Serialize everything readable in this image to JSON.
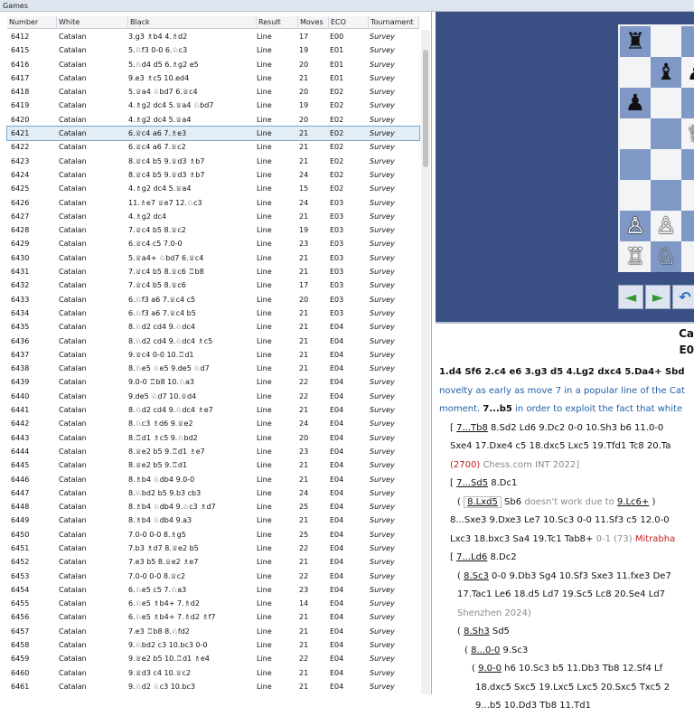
{
  "window": {
    "title": "Games"
  },
  "table": {
    "columns": [
      "Number",
      "White",
      "Black",
      "Result",
      "Moves",
      "ECO",
      "Tournament"
    ],
    "selected_number": "6421",
    "rows": [
      [
        "6412",
        "Catalan",
        "3.g3 ♗b4 4.♗d2",
        "Line",
        "17",
        "E00",
        "Survey"
      ],
      [
        "6415",
        "Catalan",
        "5.♘f3 0-0 6.♘c3",
        "Line",
        "19",
        "E01",
        "Survey"
      ],
      [
        "6416",
        "Catalan",
        "5.♘d4 d5 6.♗g2 e5",
        "Line",
        "20",
        "E01",
        "Survey"
      ],
      [
        "6417",
        "Catalan",
        "9.e3 ♗c5 10.ed4",
        "Line",
        "21",
        "E01",
        "Survey"
      ],
      [
        "6418",
        "Catalan",
        "5.♕a4 ♘bd7 6.♕c4",
        "Line",
        "20",
        "E02",
        "Survey"
      ],
      [
        "6419",
        "Catalan",
        "4.♗g2 dc4 5.♕a4 ♘bd7",
        "Line",
        "19",
        "E02",
        "Survey"
      ],
      [
        "6420",
        "Catalan",
        "4.♗g2 dc4 5.♕a4",
        "Line",
        "20",
        "E02",
        "Survey"
      ],
      [
        "6421",
        "Catalan",
        "6.♕c4 a6 7.♗e3",
        "Line",
        "21",
        "E02",
        "Survey"
      ],
      [
        "6422",
        "Catalan",
        "6.♕c4 a6 7.♕c2",
        "Line",
        "21",
        "E02",
        "Survey"
      ],
      [
        "6423",
        "Catalan",
        "8.♕c4 b5 9.♕d3 ♗b7",
        "Line",
        "21",
        "E02",
        "Survey"
      ],
      [
        "6424",
        "Catalan",
        "8.♕c4 b5 9.♕d3 ♗b7",
        "Line",
        "24",
        "E02",
        "Survey"
      ],
      [
        "6425",
        "Catalan",
        "4.♗g2 dc4 5.♕a4",
        "Line",
        "15",
        "E02",
        "Survey"
      ],
      [
        "6426",
        "Catalan",
        "11.♗e7 ♕e7 12.♘c3",
        "Line",
        "24",
        "E03",
        "Survey"
      ],
      [
        "6427",
        "Catalan",
        "4.♗g2 dc4",
        "Line",
        "21",
        "E03",
        "Survey"
      ],
      [
        "6428",
        "Catalan",
        "7.♕c4 b5 8.♕c2",
        "Line",
        "19",
        "E03",
        "Survey"
      ],
      [
        "6429",
        "Catalan",
        "6.♕c4 c5 7.0-0",
        "Line",
        "23",
        "E03",
        "Survey"
      ],
      [
        "6430",
        "Catalan",
        "5.♕a4+ ♘bd7 6.♕c4",
        "Line",
        "21",
        "E03",
        "Survey"
      ],
      [
        "6431",
        "Catalan",
        "7.♕c4 b5 8.♕c6 ♖b8",
        "Line",
        "21",
        "E03",
        "Survey"
      ],
      [
        "6432",
        "Catalan",
        "7.♕c4 b5 8.♕c6",
        "Line",
        "17",
        "E03",
        "Survey"
      ],
      [
        "6433",
        "Catalan",
        "6.♘f3 a6 7.♕c4 c5",
        "Line",
        "20",
        "E03",
        "Survey"
      ],
      [
        "6434",
        "Catalan",
        "6.♘f3 a6 7.♕c4 b5",
        "Line",
        "21",
        "E03",
        "Survey"
      ],
      [
        "6435",
        "Catalan",
        "8.♘d2 cd4 9.♘dc4",
        "Line",
        "21",
        "E04",
        "Survey"
      ],
      [
        "6436",
        "Catalan",
        "8.♘d2 cd4 9.♘dc4 ♗c5",
        "Line",
        "21",
        "E04",
        "Survey"
      ],
      [
        "6437",
        "Catalan",
        "9.♕c4 0-0 10.♖d1",
        "Line",
        "21",
        "E04",
        "Survey"
      ],
      [
        "6438",
        "Catalan",
        "8.♘e5 ♘e5 9.de5 ♘d7",
        "Line",
        "21",
        "E04",
        "Survey"
      ],
      [
        "6439",
        "Catalan",
        "9.0-0 ♖b8 10.♘a3",
        "Line",
        "22",
        "E04",
        "Survey"
      ],
      [
        "6440",
        "Catalan",
        "9.de5 ♘d7 10.♕d4",
        "Line",
        "22",
        "E04",
        "Survey"
      ],
      [
        "6441",
        "Catalan",
        "8.♘d2 cd4 9.♘dc4 ♗e7",
        "Line",
        "21",
        "E04",
        "Survey"
      ],
      [
        "6442",
        "Catalan",
        "8.♘c3 ♗d6 9.♕e2",
        "Line",
        "24",
        "E04",
        "Survey"
      ],
      [
        "6443",
        "Catalan",
        "8.♖d1 ♗c5 9.♘bd2",
        "Line",
        "20",
        "E04",
        "Survey"
      ],
      [
        "6444",
        "Catalan",
        "8.♕e2 b5 9.♖d1 ♗e7",
        "Line",
        "23",
        "E04",
        "Survey"
      ],
      [
        "6445",
        "Catalan",
        "8.♕e2 b5 9.♖d1",
        "Line",
        "21",
        "E04",
        "Survey"
      ],
      [
        "6446",
        "Catalan",
        "8.♗b4 ♘db4 9.0-0",
        "Line",
        "21",
        "E04",
        "Survey"
      ],
      [
        "6447",
        "Catalan",
        "8.♘bd2 b5 9.b3 cb3",
        "Line",
        "24",
        "E04",
        "Survey"
      ],
      [
        "6448",
        "Catalan",
        "8.♗b4 ♘db4 9.♘c3 ♗d7",
        "Line",
        "25",
        "E04",
        "Survey"
      ],
      [
        "6449",
        "Catalan",
        "8.♗b4 ♘db4 9.a3",
        "Line",
        "21",
        "E04",
        "Survey"
      ],
      [
        "6450",
        "Catalan",
        "7.0-0 0-0 8.♗g5",
        "Line",
        "25",
        "E04",
        "Survey"
      ],
      [
        "6451",
        "Catalan",
        "7.b3 ♗d7 8.♕e2 b5",
        "Line",
        "22",
        "E04",
        "Survey"
      ],
      [
        "6452",
        "Catalan",
        "7.e3 b5 8.♕e2 ♗e7",
        "Line",
        "21",
        "E04",
        "Survey"
      ],
      [
        "6453",
        "Catalan",
        "7.0-0 0-0 8.♕c2",
        "Line",
        "22",
        "E04",
        "Survey"
      ],
      [
        "6454",
        "Catalan",
        "6.♘e5 c5 7.♘a3",
        "Line",
        "23",
        "E04",
        "Survey"
      ],
      [
        "6455",
        "Catalan",
        "6.♘e5 ♗b4+ 7.♗d2",
        "Line",
        "14",
        "E04",
        "Survey"
      ],
      [
        "6456",
        "Catalan",
        "6.♘e5 ♗b4+ 7.♗d2 ♗f7",
        "Line",
        "21",
        "E04",
        "Survey"
      ],
      [
        "6457",
        "Catalan",
        "7.e3 ♖b8 8.♘fd2",
        "Line",
        "21",
        "E04",
        "Survey"
      ],
      [
        "6458",
        "Catalan",
        "9.♘bd2 c3 10.bc3 0-0",
        "Line",
        "21",
        "E04",
        "Survey"
      ],
      [
        "6459",
        "Catalan",
        "9.♕e2 b5 10.♖d1 ♗e4",
        "Line",
        "22",
        "E04",
        "Survey"
      ],
      [
        "6460",
        "Catalan",
        "9.♕d3 c4 10.♕c2",
        "Line",
        "21",
        "E04",
        "Survey"
      ],
      [
        "6461",
        "Catalan",
        "9.♘d2 ♘c3 10.bc3",
        "Line",
        "21",
        "E04",
        "Survey"
      ]
    ]
  },
  "board": {
    "pieces": [
      {
        "sq": "a8",
        "glyph": "♜",
        "side": "black"
      },
      {
        "sq": "b7",
        "glyph": "♝",
        "side": "black"
      },
      {
        "sq": "c7",
        "glyph": "♟",
        "side": "black"
      },
      {
        "sq": "a6",
        "glyph": "♟",
        "side": "black"
      },
      {
        "sq": "c5",
        "glyph": "♕",
        "side": "white"
      },
      {
        "sq": "a2",
        "glyph": "♙",
        "side": "white"
      },
      {
        "sq": "b2",
        "glyph": "♙",
        "side": "white"
      },
      {
        "sq": "a1",
        "glyph": "♖",
        "side": "white"
      },
      {
        "sq": "b1",
        "glyph": "♘",
        "side": "white"
      }
    ]
  },
  "nav": {
    "back": "◄",
    "forward": "►",
    "undo": "↶"
  },
  "game": {
    "title": "Ca",
    "eco": "E0"
  },
  "notes": {
    "l1": "1.d4  Sf6  2.c4  e6  3.g3  d5  4.Lg2  dxc4  5.Da4+  Sbd",
    "l2": "novelty as early as move 7 in a popular line of the Cat",
    "l3a": "moment.",
    "l3b": "7...b5",
    "l3c": " in order to exploit the fact that white",
    "l4a": "[ ",
    "l4b": "7...Tb8",
    "l4c": "  8.Sd2  Ld6  9.Dc2  0-0  10.Sh3  b6  11.0-0",
    "l5": "Sxe4  17.Dxe4  c5  18.dxc5  Lxc5  19.Tfd1  Tc8  20.Ta",
    "l6a": "(2700)",
    "l6b": " Chess.com INT 2022]",
    "l7a": "[ ",
    "l7b": "7...Sd5",
    "l7c": "  8.Dc1",
    "l8a": "( ",
    "l8b": "8.Lxd5",
    "l8c": "  Sb6",
    "l8d": " doesn't work due to ",
    "l8e": "9.Lc6+",
    "l8f": " )",
    "l9": "8...Sxe3  9.Dxe3  Le7  10.Sc3  0-0  11.Sf3  c5  12.0-0",
    "l10a": "Lxc3  18.bxc3  Sa4  19.Tc1  Tab8+",
    "l10b": " 0-1 (73)",
    "l10c": " Mitrabha",
    "l11a": "[ ",
    "l11b": "7...Ld6",
    "l11c": "  8.Dc2",
    "l12a": "( ",
    "l12b": "8.Sc3",
    "l12c": "  0-0  9.Db3  Sg4  10.Sf3  Sxe3  11.fxe3  De7",
    "l13": "17.Tac1  Le6  18.d5  Ld7  19.Sc5  Lc8  20.Se4  Ld7",
    "l14": "Shenzhen 2024)",
    "l15a": "( ",
    "l15b": "8.Sh3",
    "l15c": "  Sd5",
    "l16a": "( ",
    "l16b": "8...0-0",
    "l16c": "  9.Sc3",
    "l17a": "( ",
    "l17b": "9.0-0",
    "l17c": "  h6  10.Sc3  b5  11.Db3  Tb8  12.Sf4  Lf",
    "l18": "18.dxc5  Sxc5  19.Lxc5  Lxc5  20.Sxc5  Txc5  2",
    "l19": "9...b5  10.Dd3  Tb8  11.Td1"
  }
}
